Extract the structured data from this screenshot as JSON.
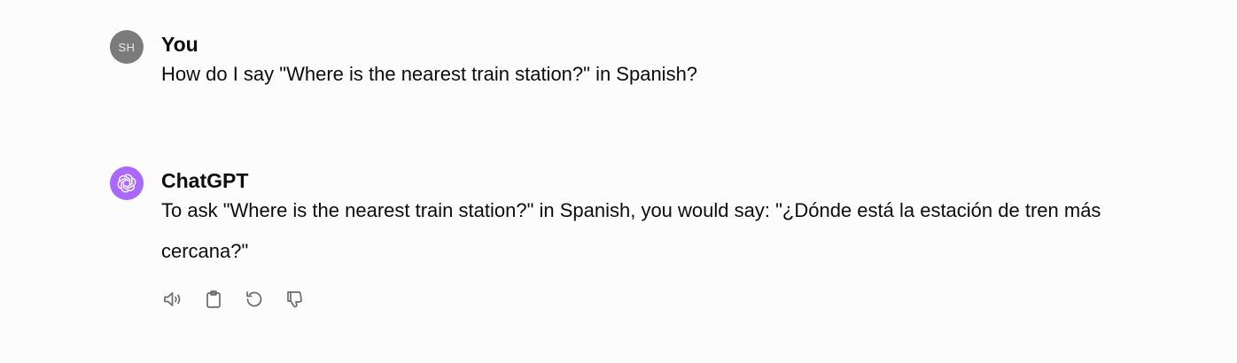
{
  "conversation": {
    "user_message": {
      "avatar_initials": "SH",
      "author": "You",
      "text": "How do I say \"Where is the nearest train station?\" in Spanish?"
    },
    "assistant_message": {
      "avatar_icon": "openai-logo-icon",
      "author": "ChatGPT",
      "text": "To ask \"Where is the nearest train station?\" in Spanish, you would say: \"¿Dónde está la estación de tren más cercana?\"",
      "actions": [
        {
          "name": "read-aloud",
          "icon": "speaker-icon"
        },
        {
          "name": "copy",
          "icon": "clipboard-icon"
        },
        {
          "name": "regenerate",
          "icon": "refresh-icon"
        },
        {
          "name": "bad-response",
          "icon": "thumbs-down-icon"
        }
      ]
    }
  },
  "colors": {
    "background": "#fdfcfd",
    "user_avatar": "#7b7b7b",
    "assistant_avatar": "#ab68ff",
    "icon_stroke": "#6b6b6b"
  }
}
